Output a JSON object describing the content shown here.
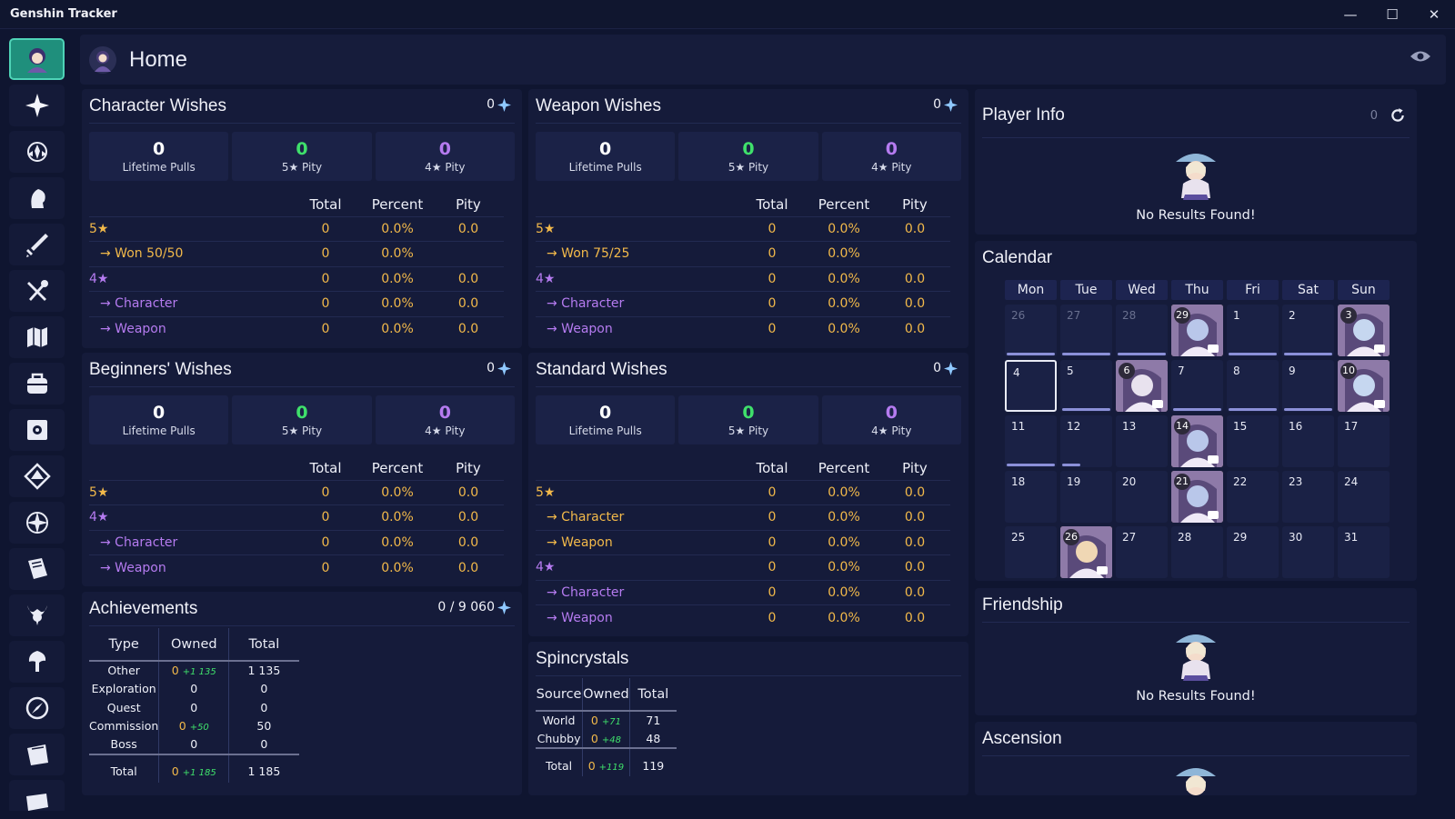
{
  "window": {
    "title": "Genshin Tracker",
    "minimize": "—",
    "maximize": "☐",
    "close": "✕"
  },
  "sidebar": {
    "items": [
      {
        "name": "home",
        "icon": "character-avatar-icon"
      },
      {
        "name": "wishes",
        "icon": "sparkle-icon"
      },
      {
        "name": "achievements",
        "icon": "emblem-icon"
      },
      {
        "name": "characters",
        "icon": "character-head-icon"
      },
      {
        "name": "weapons",
        "icon": "sword-icon"
      },
      {
        "name": "food",
        "icon": "fork-knife-icon"
      },
      {
        "name": "map",
        "icon": "map-icon"
      },
      {
        "name": "inventory",
        "icon": "bag-icon"
      },
      {
        "name": "artifacts",
        "icon": "flower-box-icon"
      },
      {
        "name": "elements",
        "icon": "element-diamond-icon"
      },
      {
        "name": "talents",
        "icon": "compass-star-icon"
      },
      {
        "name": "books",
        "icon": "book-icon"
      },
      {
        "name": "bosses",
        "icon": "boss-horns-icon"
      },
      {
        "name": "domains",
        "icon": "tree-icon"
      },
      {
        "name": "expeditions",
        "icon": "compass-icon"
      },
      {
        "name": "quests",
        "icon": "quest-book-icon"
      },
      {
        "name": "notes",
        "icon": "scroll-icon"
      }
    ]
  },
  "header": {
    "title": "Home",
    "visibility_icon": "eye-icon"
  },
  "character_wishes": {
    "title": "Character Wishes",
    "count": "0",
    "stats": [
      {
        "value": "0",
        "label": "Lifetime Pulls"
      },
      {
        "value": "0",
        "label": "5★ Pity"
      },
      {
        "value": "0",
        "label": "4★ Pity"
      }
    ],
    "columns": [
      "Total",
      "Percent",
      "Pity"
    ],
    "rows": [
      {
        "label": "5★",
        "total": "0",
        "percent": "0.0%",
        "pity": "0.0"
      },
      {
        "label": "→ Won 50/50",
        "total": "0",
        "percent": "0.0%",
        "pity": ""
      },
      {
        "label": "4★",
        "total": "0",
        "percent": "0.0%",
        "pity": "0.0"
      },
      {
        "label": "→ Character",
        "total": "0",
        "percent": "0.0%",
        "pity": "0.0"
      },
      {
        "label": "→ Weapon",
        "total": "0",
        "percent": "0.0%",
        "pity": "0.0"
      }
    ]
  },
  "weapon_wishes": {
    "title": "Weapon Wishes",
    "count": "0",
    "stats": [
      {
        "value": "0",
        "label": "Lifetime Pulls"
      },
      {
        "value": "0",
        "label": "5★ Pity"
      },
      {
        "value": "0",
        "label": "4★ Pity"
      }
    ],
    "columns": [
      "Total",
      "Percent",
      "Pity"
    ],
    "rows": [
      {
        "label": "5★",
        "total": "0",
        "percent": "0.0%",
        "pity": "0.0"
      },
      {
        "label": "→ Won 75/25",
        "total": "0",
        "percent": "0.0%",
        "pity": ""
      },
      {
        "label": "4★",
        "total": "0",
        "percent": "0.0%",
        "pity": "0.0"
      },
      {
        "label": "→ Character",
        "total": "0",
        "percent": "0.0%",
        "pity": "0.0"
      },
      {
        "label": "→ Weapon",
        "total": "0",
        "percent": "0.0%",
        "pity": "0.0"
      }
    ]
  },
  "beginners_wishes": {
    "title": "Beginners' Wishes",
    "count": "0",
    "stats": [
      {
        "value": "0",
        "label": "Lifetime Pulls"
      },
      {
        "value": "0",
        "label": "5★ Pity"
      },
      {
        "value": "0",
        "label": "4★ Pity"
      }
    ],
    "columns": [
      "Total",
      "Percent",
      "Pity"
    ],
    "rows": [
      {
        "label": "5★",
        "total": "0",
        "percent": "0.0%",
        "pity": "0.0"
      },
      {
        "label": "4★",
        "total": "0",
        "percent": "0.0%",
        "pity": "0.0"
      },
      {
        "label": "→ Character",
        "total": "0",
        "percent": "0.0%",
        "pity": "0.0"
      },
      {
        "label": "→ Weapon",
        "total": "0",
        "percent": "0.0%",
        "pity": "0.0"
      }
    ]
  },
  "standard_wishes": {
    "title": "Standard Wishes",
    "count": "0",
    "stats": [
      {
        "value": "0",
        "label": "Lifetime Pulls"
      },
      {
        "value": "0",
        "label": "5★ Pity"
      },
      {
        "value": "0",
        "label": "4★ Pity"
      }
    ],
    "columns": [
      "Total",
      "Percent",
      "Pity"
    ],
    "rows": [
      {
        "label": "5★",
        "total": "0",
        "percent": "0.0%",
        "pity": "0.0"
      },
      {
        "label": "→ Character",
        "total": "0",
        "percent": "0.0%",
        "pity": "0.0"
      },
      {
        "label": "→ Weapon",
        "total": "0",
        "percent": "0.0%",
        "pity": "0.0"
      },
      {
        "label": "4★",
        "total": "0",
        "percent": "0.0%",
        "pity": "0.0"
      },
      {
        "label": "→ Character",
        "total": "0",
        "percent": "0.0%",
        "pity": "0.0"
      },
      {
        "label": "→ Weapon",
        "total": "0",
        "percent": "0.0%",
        "pity": "0.0"
      }
    ]
  },
  "achievements": {
    "title": "Achievements",
    "count": "0 / 9 060",
    "columns": [
      "Type",
      "Owned",
      "Total"
    ],
    "rows": [
      {
        "type": "Other",
        "owned": "0",
        "bonus": "+1 135",
        "total": "1 135"
      },
      {
        "type": "Exploration",
        "owned": "0",
        "bonus": "",
        "total": "0"
      },
      {
        "type": "Quest",
        "owned": "0",
        "bonus": "",
        "total": "0"
      },
      {
        "type": "Commission",
        "owned": "0",
        "bonus": "+50",
        "total": "50"
      },
      {
        "type": "Boss",
        "owned": "0",
        "bonus": "",
        "total": "0"
      }
    ],
    "total_row": {
      "type": "Total",
      "owned": "0",
      "bonus": "+1 185",
      "total": "1 185"
    }
  },
  "spincrystals": {
    "title": "Spincrystals",
    "columns": [
      "Source",
      "Owned",
      "Total"
    ],
    "rows": [
      {
        "source": "World",
        "owned": "0",
        "bonus": "+71",
        "total": "71"
      },
      {
        "source": "Chubby",
        "owned": "0",
        "bonus": "+48",
        "total": "48"
      }
    ],
    "total_row": {
      "source": "Total",
      "owned": "0",
      "bonus": "+119",
      "total": "119"
    }
  },
  "player_info": {
    "title": "Player Info",
    "count": "0",
    "refresh_icon": "refresh-icon",
    "empty_text": "No Results Found!"
  },
  "calendar": {
    "title": "Calendar",
    "weekdays": [
      "Mon",
      "Tue",
      "Wed",
      "Thu",
      "Fri",
      "Sat",
      "Sun"
    ],
    "days": [
      {
        "d": "26",
        "muted": true,
        "bar": "full"
      },
      {
        "d": "27",
        "muted": true,
        "bar": "full"
      },
      {
        "d": "28",
        "muted": true,
        "bar": "full"
      },
      {
        "d": "29",
        "muted": true,
        "birthday": true,
        "bar": ""
      },
      {
        "d": "1",
        "bar": "full"
      },
      {
        "d": "2",
        "bar": "full"
      },
      {
        "d": "3",
        "birthday": true,
        "bar": ""
      },
      {
        "d": "4",
        "today": true,
        "bar": ""
      },
      {
        "d": "5",
        "bar": "full"
      },
      {
        "d": "6",
        "birthday": true,
        "bar": ""
      },
      {
        "d": "7",
        "bar": "full"
      },
      {
        "d": "8",
        "bar": "full"
      },
      {
        "d": "9",
        "bar": "full"
      },
      {
        "d": "10",
        "birthday": true,
        "bar": ""
      },
      {
        "d": "11",
        "bar": "full"
      },
      {
        "d": "12",
        "bar": "half"
      },
      {
        "d": "13",
        "bar": ""
      },
      {
        "d": "14",
        "birthday": true,
        "bar": ""
      },
      {
        "d": "15",
        "bar": ""
      },
      {
        "d": "16",
        "bar": ""
      },
      {
        "d": "17",
        "bar": ""
      },
      {
        "d": "18",
        "bar": ""
      },
      {
        "d": "19",
        "bar": ""
      },
      {
        "d": "20",
        "bar": ""
      },
      {
        "d": "21",
        "birthday": true,
        "bar": ""
      },
      {
        "d": "22",
        "bar": ""
      },
      {
        "d": "23",
        "bar": ""
      },
      {
        "d": "24",
        "bar": ""
      },
      {
        "d": "25",
        "bar": ""
      },
      {
        "d": "26",
        "birthday": true,
        "bar": ""
      },
      {
        "d": "27",
        "bar": ""
      },
      {
        "d": "28",
        "bar": ""
      },
      {
        "d": "29",
        "bar": ""
      },
      {
        "d": "30",
        "bar": ""
      },
      {
        "d": "31",
        "bar": ""
      }
    ]
  },
  "friendship": {
    "title": "Friendship",
    "empty_text": "No Results Found!"
  },
  "ascension": {
    "title": "Ascension"
  },
  "colors": {
    "gold": "#f2b94a",
    "green": "#3fe06b",
    "purple": "#b57bf0",
    "accent": "#1f8f7c"
  }
}
